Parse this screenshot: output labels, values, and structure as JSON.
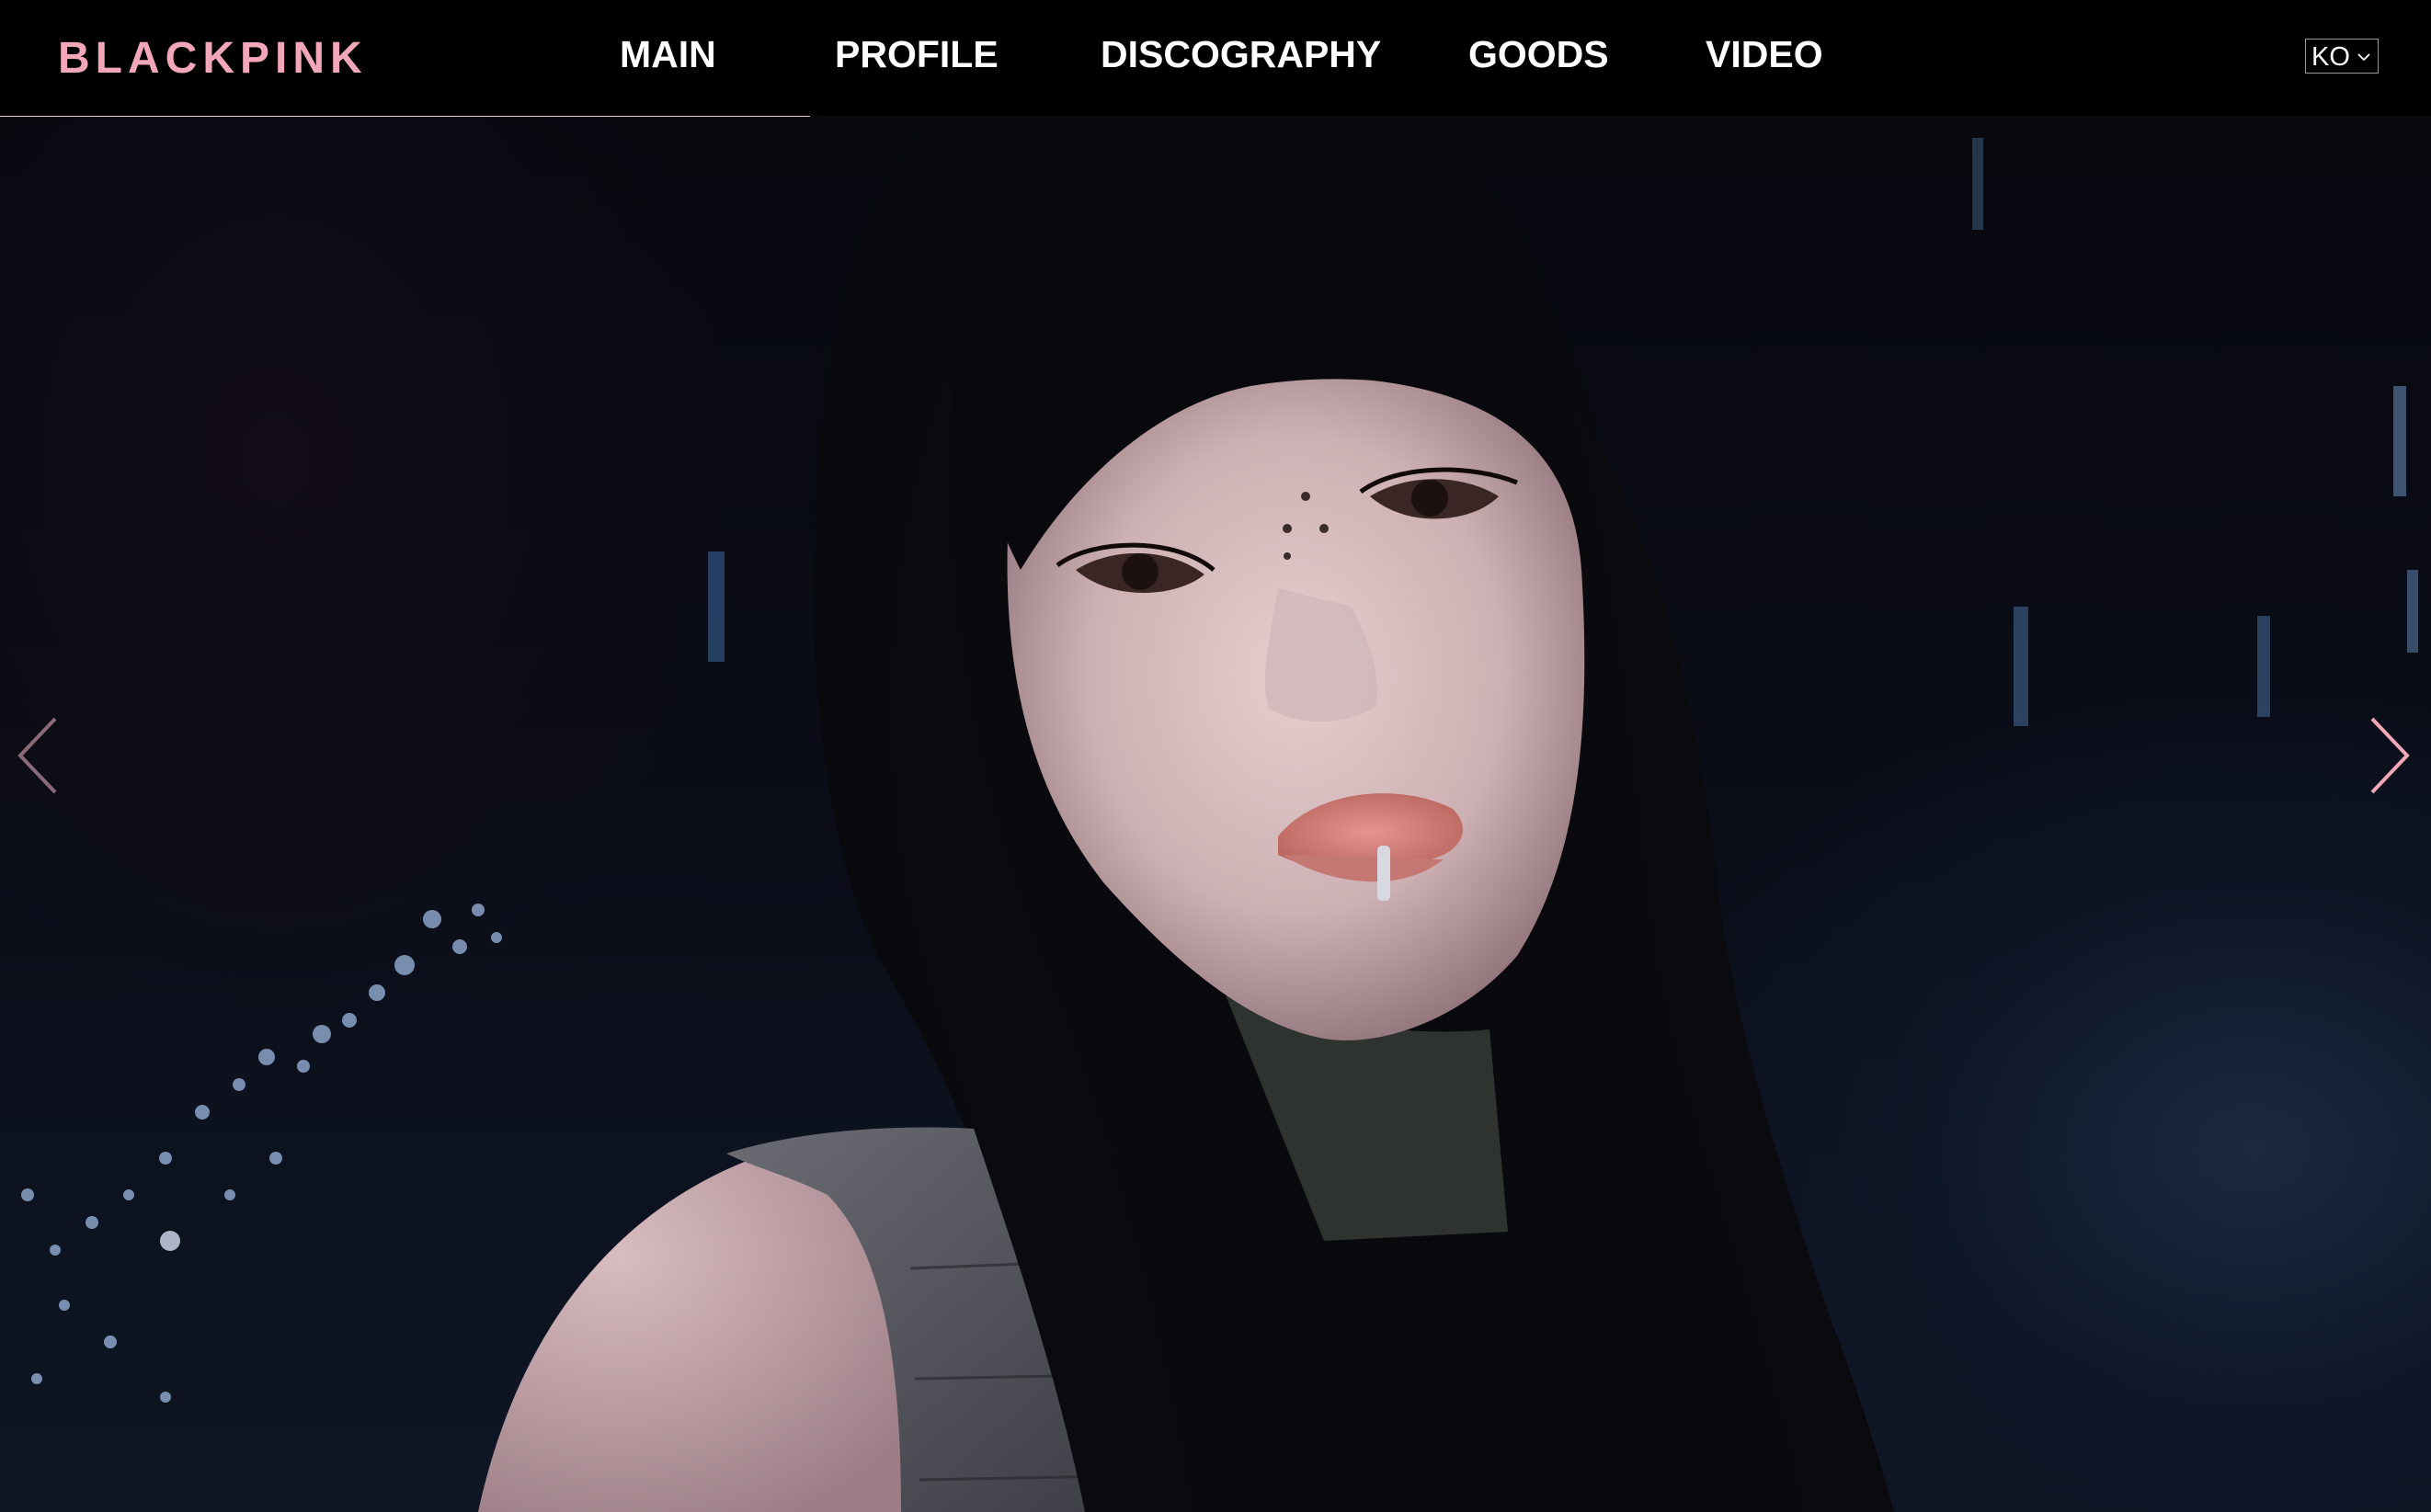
{
  "brand": {
    "logo_text": "BLACKPINK",
    "accent_color": "#f2a7b9"
  },
  "nav": {
    "items": [
      {
        "label": "MAIN",
        "active": true
      },
      {
        "label": "PROFILE",
        "active": false
      },
      {
        "label": "DISCOGRAPHY",
        "active": false
      },
      {
        "label": "GOODS",
        "active": false
      },
      {
        "label": "VIDEO",
        "active": false
      }
    ]
  },
  "language": {
    "selected": "KO"
  },
  "slider": {
    "prev_icon": "chevron-left-icon",
    "next_icon": "chevron-right-icon"
  },
  "hero": {
    "image": "member-portrait-photo"
  }
}
